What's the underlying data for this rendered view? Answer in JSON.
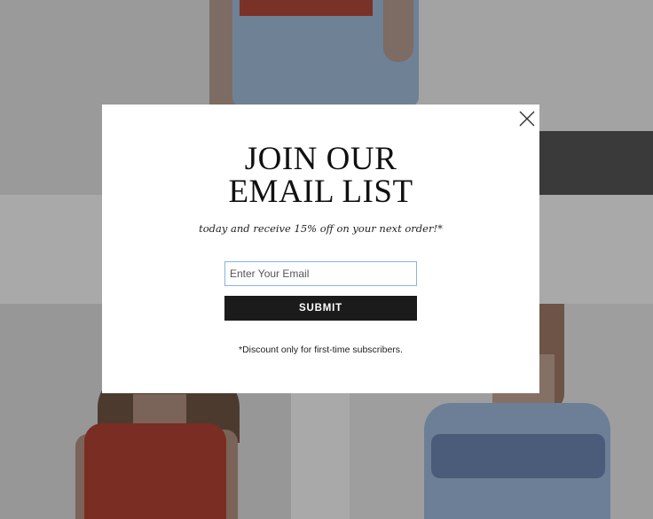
{
  "popup": {
    "headline_line1": "JOIN OUR",
    "headline_line2": "EMAIL LIST",
    "subheadline": "today and receive 15% off on your next order!*",
    "email_placeholder": "Enter Your Email",
    "submit_label": "SUBMIT",
    "disclaimer": "*Discount only for first-time subscribers.",
    "close_icon": "close-icon"
  },
  "colors": {
    "modal_background": "#ffffff",
    "button_background": "#1b1b1b",
    "button_text": "#ffffff",
    "input_border_focus": "#8ab2e2",
    "overlay": "#8d8d8d"
  }
}
